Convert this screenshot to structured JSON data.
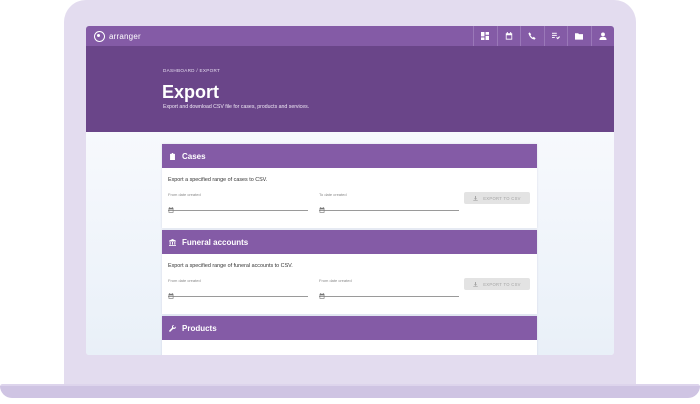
{
  "app": {
    "brand": "arranger"
  },
  "topbar": {
    "icons": [
      "dashboard-icon",
      "calendar-icon",
      "phone-icon",
      "tasks-icon",
      "folder-icon",
      "user-icon"
    ]
  },
  "header": {
    "breadcrumb": "DASHBOARD / EXPORT",
    "title": "Export",
    "subtitle": "Export and download CSV file for cases, products and services."
  },
  "cards": [
    {
      "title": "Cases",
      "icon": "clipboard-icon",
      "description": "Export a specified range of cases to CSV.",
      "from_label": "From date created",
      "to_label": "To date created",
      "button_label": "EXPORT TO CSV"
    },
    {
      "title": "Funeral accounts",
      "icon": "bank-icon",
      "description": "Export a specified range of funeral accounts to CSV.",
      "from_label": "From date created",
      "to_label": "From date created",
      "button_label": "EXPORT TO CSV"
    },
    {
      "title": "Products",
      "icon": "wrench-icon"
    }
  ],
  "colors": {
    "topbar": "#845ba6",
    "hero": "#6a4589",
    "card_header": "#845ba6",
    "frame": "#e3dcef"
  }
}
